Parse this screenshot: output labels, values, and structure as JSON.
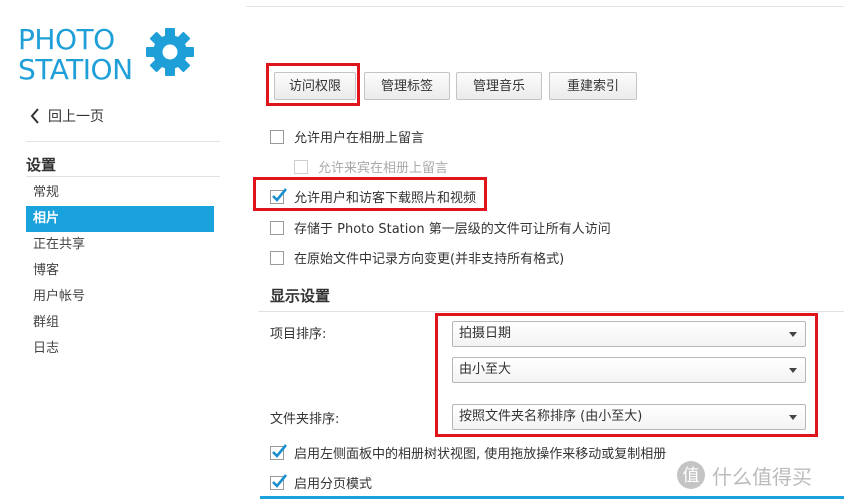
{
  "logo": {
    "line1": "PHOTO",
    "line2": "STATION",
    "icon": "gear-icon",
    "color": "#1e9fd8"
  },
  "sidebar": {
    "back_label": "回上一页",
    "section_title": "设置",
    "items": [
      {
        "label": "常规"
      },
      {
        "label": "相片"
      },
      {
        "label": "正在共享"
      },
      {
        "label": "博客"
      },
      {
        "label": "用户帐号"
      },
      {
        "label": "群组"
      },
      {
        "label": "日志"
      }
    ],
    "active_index": 1,
    "accent": "#1aa2dc"
  },
  "toolbar": {
    "buttons": [
      {
        "label": "访问权限"
      },
      {
        "label": "管理标签"
      },
      {
        "label": "管理音乐"
      },
      {
        "label": "重建索引"
      }
    ]
  },
  "options": [
    {
      "label": "允许用户在相册上留言",
      "checked": false,
      "disabled": false
    },
    {
      "label": "允许来宾在相册上留言",
      "checked": false,
      "disabled": true
    },
    {
      "label": "允许用户和访客下载照片和视频",
      "checked": true,
      "disabled": false
    },
    {
      "label": "存储于 Photo Station 第一层级的文件可让所有人访问",
      "checked": false,
      "disabled": false
    },
    {
      "label": "在原始文件中记录方向变更(并非支持所有格式)",
      "checked": false,
      "disabled": false
    }
  ],
  "display_settings": {
    "title": "显示设置",
    "item_sort_label": "项目排序:",
    "item_sort_field": "拍摄日期",
    "item_sort_order": "由小至大",
    "folder_sort_label": "文件夹排序:",
    "folder_sort_value": "按照文件夹名称排序 (由小至大)"
  },
  "bottom_options": [
    {
      "label": "启用左侧面板中的相册树状视图, 使用拖放操作来移动或复制相册",
      "checked": true
    },
    {
      "label": "启用分页模式",
      "checked": true
    }
  ],
  "watermark": {
    "text": "什么值得买",
    "icon": "zhi-badge-icon"
  },
  "highlight_color": "#e0151b"
}
